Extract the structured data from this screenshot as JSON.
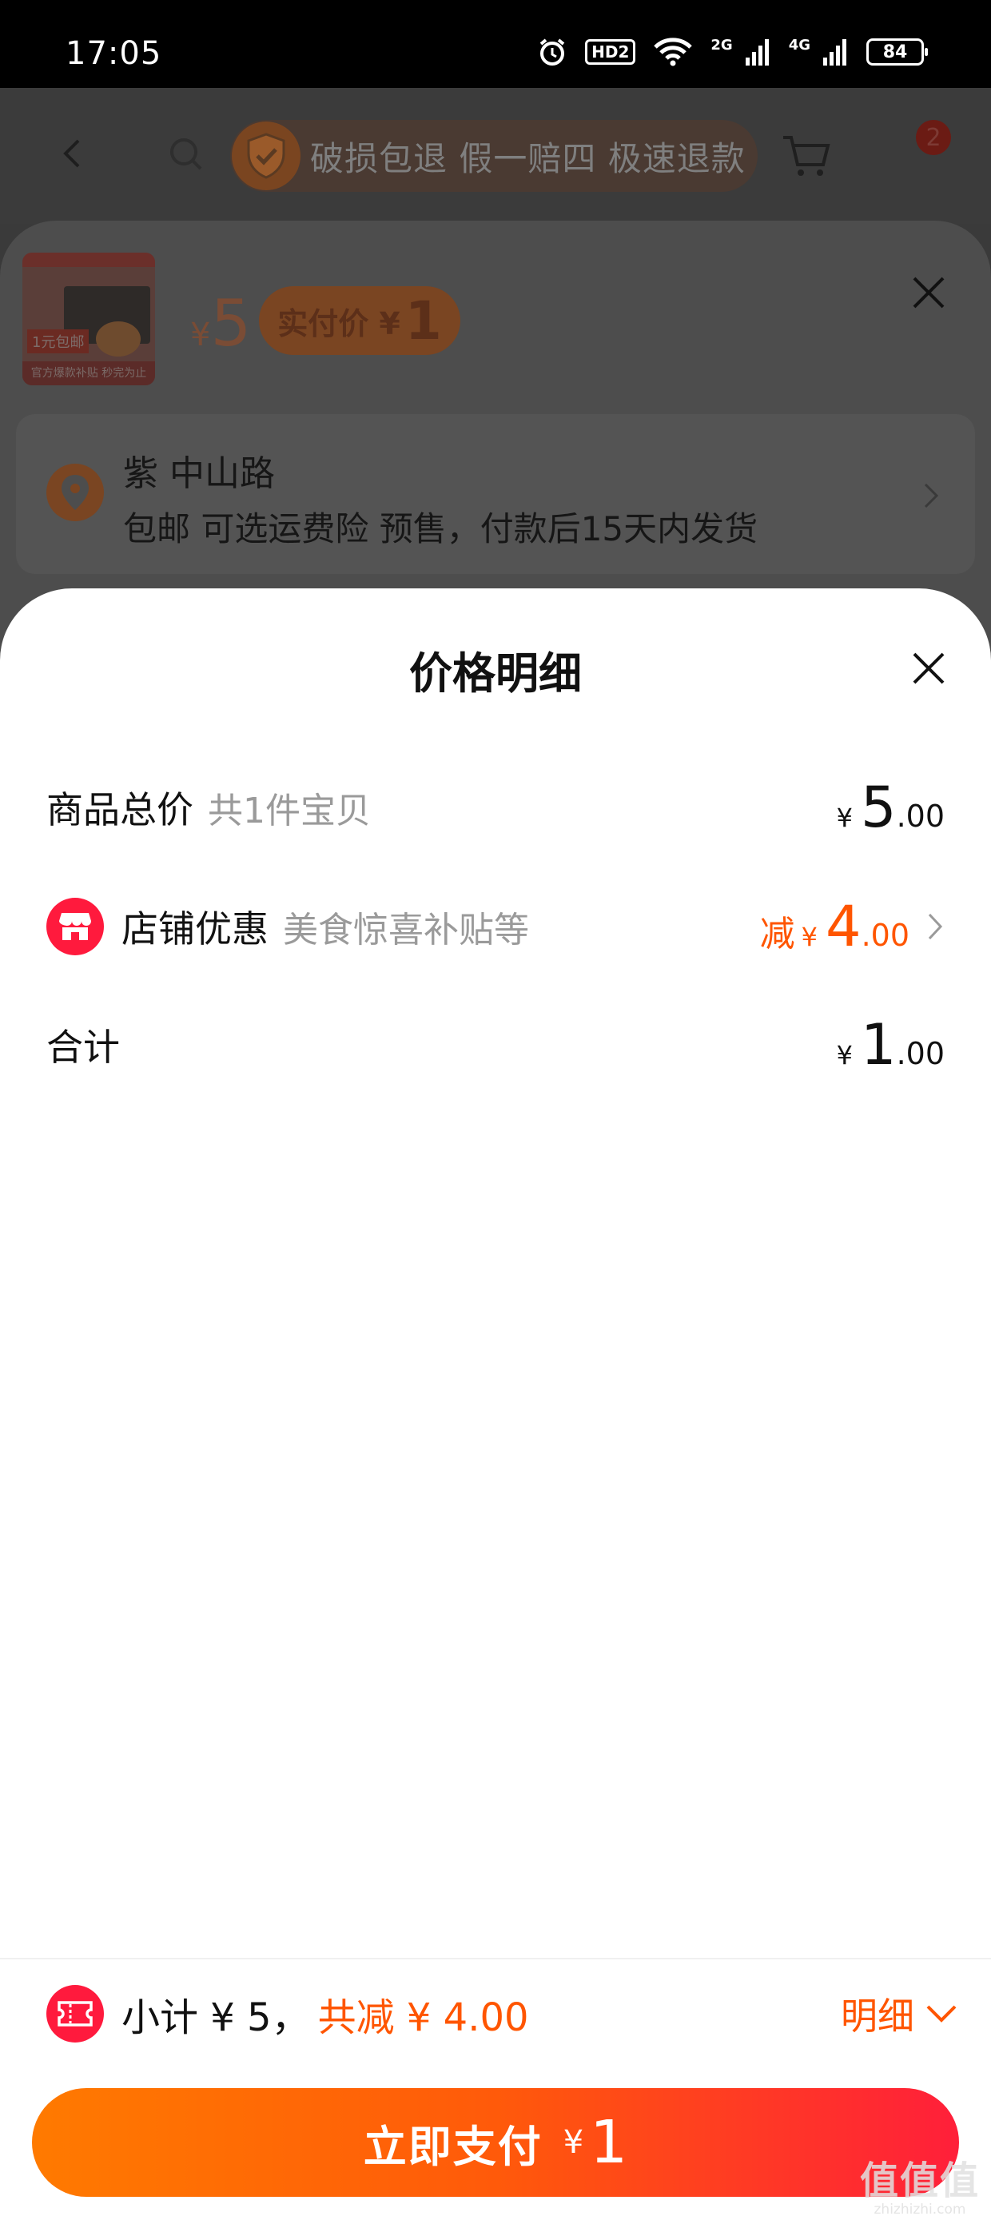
{
  "status_bar": {
    "time": "17:05",
    "hd": "HD2",
    "net_2g": "2G",
    "net_4g": "4G",
    "battery": "84"
  },
  "top_nav": {
    "guarantee_text": "破损包退 假一赔四 极速退款",
    "message_count": "2"
  },
  "sku_sheet": {
    "thumbnail": {
      "tag": "1元包邮",
      "caption": "官方爆款补贴 秒完为止"
    },
    "price_symbol": "¥",
    "price": "5",
    "paid_label": "实付价 ¥",
    "paid_amount": "1",
    "address_name": "紫 中山路",
    "address_detail": "包邮 可选运费险 预售，付款后15天内发货"
  },
  "price_detail": {
    "title": "价格明细",
    "rows": [
      {
        "label": "商品总价",
        "sub": "共1件宝贝",
        "yen": "¥",
        "int": "5",
        "dec": ".00"
      },
      {
        "label": "店铺优惠",
        "sub": "美食惊喜补贴等",
        "prefix": "减",
        "yen": "¥",
        "int": "4",
        "dec": ".00"
      },
      {
        "label": "合计",
        "sub": "",
        "yen": "¥",
        "int": "1",
        "dec": ".00"
      }
    ]
  },
  "summary": {
    "subtotal": "小计 ¥ 5，",
    "reduce": "共减 ¥ 4.00",
    "detail_label": "明细"
  },
  "pay_button": {
    "label": "立即支付",
    "yen": "¥",
    "amount": "1"
  },
  "watermark": {
    "main": "值值值",
    "sub": "zhizhizhi.com"
  },
  "colors": {
    "accent_orange": "#ff5500",
    "accent_red": "#ff1a3d",
    "gradient_start": "#ff7a00",
    "gradient_end": "#ff1f3a"
  }
}
